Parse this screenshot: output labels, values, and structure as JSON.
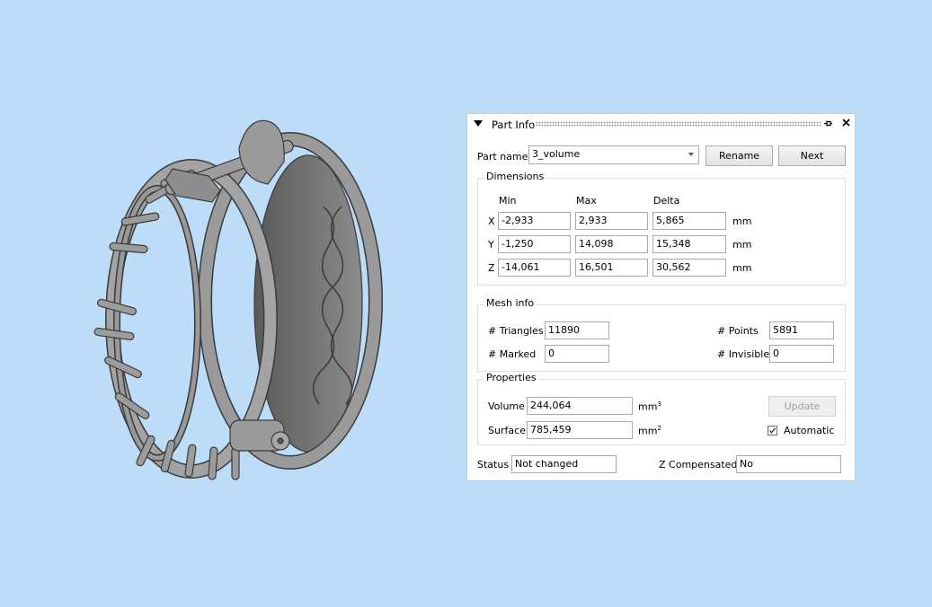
{
  "colors": {
    "background": "#bcdcf7",
    "model": "#8e8e8e",
    "model_dark": "#4a4a4a",
    "panel": "#ffffff"
  },
  "panel": {
    "title": "Part Info",
    "part_name_label": "Part name",
    "part_name_value": "3_volume",
    "rename_label": "Rename",
    "next_label": "Next",
    "dimensions": {
      "title": "Dimensions",
      "headers": [
        "Min",
        "Max",
        "Delta"
      ],
      "rows": [
        {
          "axis": "X",
          "min": "-2,933",
          "max": "2,933",
          "delta": "5,865",
          "unit": "mm"
        },
        {
          "axis": "Y",
          "min": "-1,250",
          "max": "14,098",
          "delta": "15,348",
          "unit": "mm"
        },
        {
          "axis": "Z",
          "min": "-14,061",
          "max": "16,501",
          "delta": "30,562",
          "unit": "mm"
        }
      ]
    },
    "mesh": {
      "title": "Mesh info",
      "triangles_label": "# Triangles",
      "triangles_value": "11890",
      "points_label": "# Points",
      "points_value": "5891",
      "marked_label": "# Marked",
      "marked_value": "0",
      "invisible_label": "# Invisible",
      "invisible_value": "0"
    },
    "properties": {
      "title": "Properties",
      "volume_label": "Volume",
      "volume_value": "244,064",
      "volume_unit": "mm",
      "volume_unit_exp": "3",
      "surface_label": "Surface",
      "surface_value": "785,459",
      "surface_unit": "mm",
      "surface_unit_exp": "2",
      "update_label": "Update",
      "automatic_label": "Automatic",
      "automatic_checked": true
    },
    "status_label": "Status",
    "status_value": "Not changed",
    "zcomp_label": "Z Compensated",
    "zcomp_value": "No"
  }
}
